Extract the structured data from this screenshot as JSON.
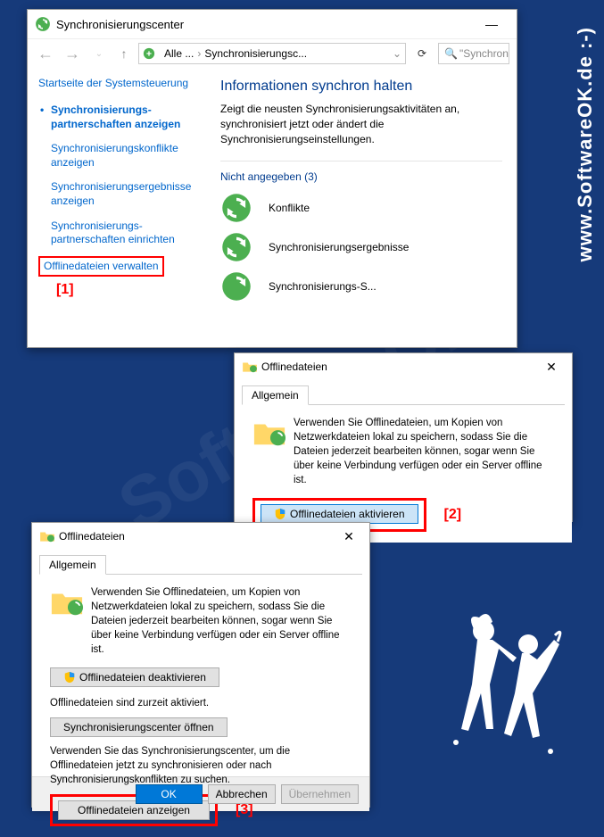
{
  "watermark": "www.SoftwareOK.de :-)",
  "watermark_center": "SoftwareOK",
  "annotations": {
    "a1": "[1]",
    "a2": "[2]",
    "a3": "[3]"
  },
  "window1": {
    "title": "Synchronisierungscenter",
    "minimize": "—",
    "breadcrumb": {
      "alle": "Alle ...",
      "sep": "›",
      "current": "Synchronisierungsc...",
      "chevron": "⌄"
    },
    "refresh": "⟳",
    "search_placeholder": "\"Synchron",
    "sidebar": {
      "heading": "Startseite der Systemsteuerung",
      "items": [
        "Synchronisierungs-partnerschaften anzeigen",
        "Synchronisierungskonflikte anzeigen",
        "Synchronisierungsergebnisse anzeigen",
        "Synchronisierungs-partnerschaften einrichten",
        "Offlinedateien verwalten"
      ]
    },
    "main": {
      "heading": "Informationen synchron halten",
      "desc": "Zeigt die neusten Synchronisierungsaktivitäten an, synchronisiert jetzt oder ändert die Synchronisierungseinstellungen.",
      "section": "Nicht angegeben (3)",
      "rows": [
        "Konflikte",
        "Synchronisierungsergebnisse",
        "Synchronisierungs-S..."
      ]
    }
  },
  "window2": {
    "title": "Offlinedateien",
    "tab": "Allgemein",
    "info": "Verwenden Sie Offlinedateien, um Kopien von Netzwerkdateien lokal zu speichern, sodass Sie die Dateien jederzeit bearbeiten können, sogar wenn Sie über keine Verbindung verfügen oder ein Server offline ist.",
    "button": "Offlinedateien aktivieren"
  },
  "window3": {
    "title": "Offlinedateien",
    "tab": "Allgemein",
    "info": "Verwenden Sie Offlinedateien, um Kopien von Netzwerkdateien lokal zu speichern, sodass Sie die Dateien jederzeit bearbeiten können, sogar wenn Sie über keine Verbindung verfügen oder ein Server offline ist.",
    "deactivate": "Offlinedateien deaktivieren",
    "status": "Offlinedateien sind zurzeit aktiviert.",
    "open_sync": "Synchronisierungscenter öffnen",
    "desc2": "Verwenden Sie das Synchronisierungscenter, um die Offlinedateien jetzt zu synchronisieren oder nach Synchronisierungskonflikten zu suchen.",
    "show": "Offlinedateien anzeigen",
    "ok": "OK",
    "cancel": "Abbrechen",
    "apply": "Übernehmen"
  }
}
